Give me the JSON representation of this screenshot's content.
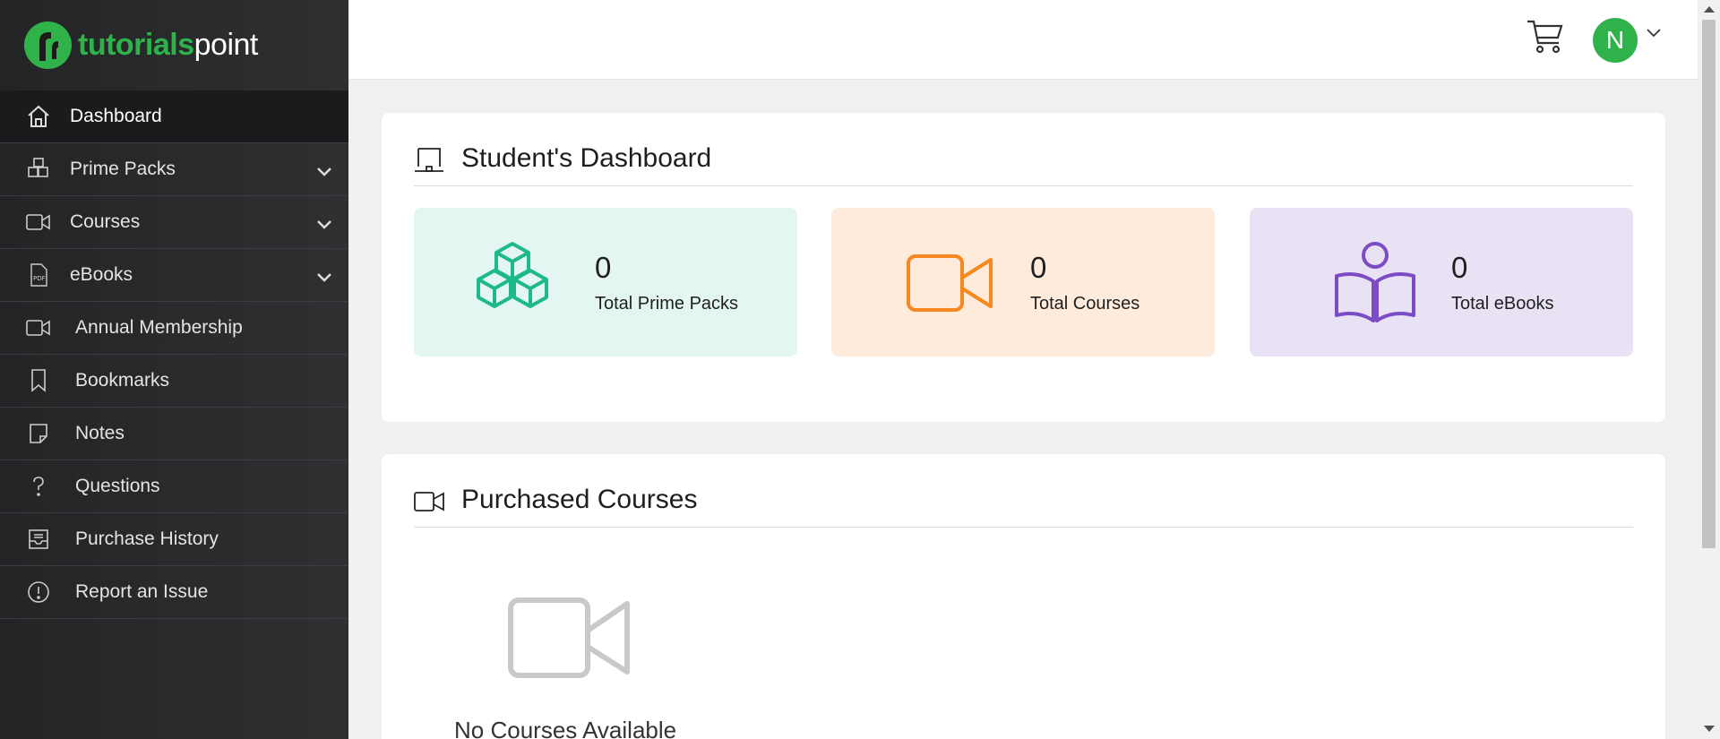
{
  "brand": {
    "part1": "tutorials",
    "part2": "point"
  },
  "sidebar": {
    "items": [
      {
        "label": "Dashboard"
      },
      {
        "label": "Prime Packs"
      },
      {
        "label": "Courses"
      },
      {
        "label": "eBooks"
      },
      {
        "label": "Annual Membership"
      },
      {
        "label": "Bookmarks"
      },
      {
        "label": "Notes"
      },
      {
        "label": "Questions"
      },
      {
        "label": "Purchase History"
      },
      {
        "label": "Report an Issue"
      }
    ]
  },
  "header": {
    "avatar_initial": "N"
  },
  "dashboard": {
    "title": "Student's Dashboard",
    "stats": [
      {
        "value": "0",
        "label": "Total Prime Packs",
        "color": "#1db98a"
      },
      {
        "value": "0",
        "label": "Total Courses",
        "color": "#f7871f"
      },
      {
        "value": "0",
        "label": "Total eBooks",
        "color": "#7b4cc4"
      }
    ]
  },
  "purchased": {
    "title": "Purchased Courses",
    "empty_text": "No Courses Available"
  },
  "colors": {
    "brand_green": "#2fb24a",
    "sidebar_bg": "#2a2b2d"
  }
}
